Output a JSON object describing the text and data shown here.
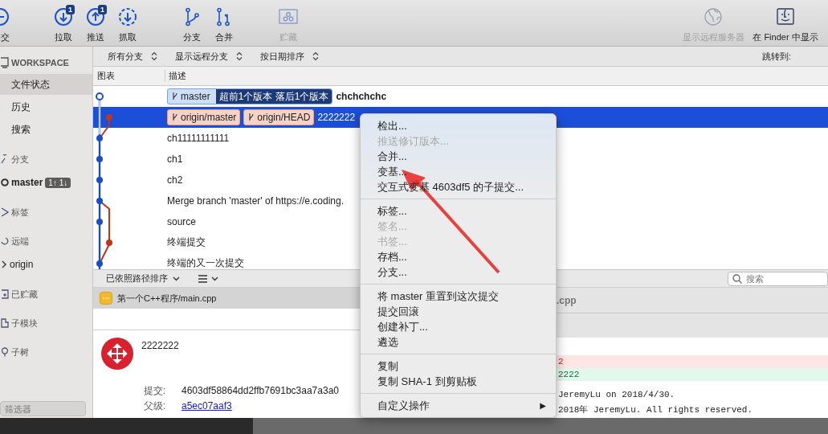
{
  "toolbar": {
    "groups": [
      [
        {
          "label": "交",
          "disabled": false
        }
      ],
      [
        {
          "label": "拉取",
          "badge": "1",
          "disabled": false
        },
        {
          "label": "推送",
          "badge": "1",
          "disabled": false
        },
        {
          "label": "抓取",
          "disabled": false
        }
      ],
      [
        {
          "label": "分支",
          "disabled": false
        },
        {
          "label": "合并",
          "disabled": false
        }
      ],
      [
        {
          "label": "贮藏",
          "disabled": true
        }
      ]
    ],
    "right_items": [
      {
        "label": "显示远程服务器",
        "disabled": true
      },
      {
        "label": "在 Finder 中显示",
        "disabled": false
      }
    ]
  },
  "sidebar": {
    "workspace": {
      "label": "WORKSPACE",
      "items": [
        {
          "label": "文件状态",
          "selected": true
        },
        {
          "label": "历史",
          "selected": false
        },
        {
          "label": "搜索",
          "selected": false
        }
      ]
    },
    "sections": [
      {
        "label": "分支",
        "children": [
          {
            "label": "master",
            "badge": "1↑ 1↓",
            "kind": "current"
          }
        ]
      },
      {
        "label": "标签"
      },
      {
        "label": "远端",
        "children": [
          {
            "label": "origin",
            "kind": "remote",
            "expanded": false
          }
        ]
      },
      {
        "label": "已贮藏"
      },
      {
        "label": "子模块"
      },
      {
        "label": "子树"
      }
    ],
    "filter": {
      "placeholder": "筛选器"
    }
  },
  "filter_bar": {
    "dropdowns": [
      "所有分支",
      "显示远程分支",
      "按日期排序"
    ],
    "jump_label": "跳转到:"
  },
  "table": {
    "columns": [
      "图表",
      "描述"
    ],
    "rows": [
      {
        "selected": false,
        "head": true,
        "tags": [
          {
            "label": "master",
            "kind": "local"
          }
        ],
        "status": "超前1个版本 落后1个版本",
        "message": "chchchchc"
      },
      {
        "selected": true,
        "head": false,
        "tags": [
          {
            "label": "origin/master",
            "kind": "remote"
          },
          {
            "label": "origin/HEAD",
            "kind": "remote"
          }
        ],
        "message": "2222222"
      },
      {
        "selected": false,
        "head": false,
        "message": "ch11111111111"
      },
      {
        "selected": false,
        "head": false,
        "message": "ch1"
      },
      {
        "selected": false,
        "head": false,
        "message": "ch2"
      },
      {
        "selected": false,
        "head": false,
        "message": "Merge branch 'master' of https://e.coding."
      },
      {
        "selected": false,
        "head": false,
        "message": "source"
      },
      {
        "selected": false,
        "head": false,
        "message": "终端提交"
      },
      {
        "selected": false,
        "head": false,
        "message": "终端的又一次提交"
      }
    ]
  },
  "file_panel": {
    "sort_label": "已依照路径排序",
    "search": {
      "placeholder": "搜索"
    },
    "files": [
      {
        "path": "第一个C++程序/main.cpp",
        "selected": true
      }
    ],
    "commit": {
      "message": "2222222",
      "fields": [
        {
          "label": "提交:",
          "value": "4603df58864dd2ffb7691bc3aa7a3a0",
          "kind": "text"
        },
        {
          "label": "父级:",
          "value": "a5ec07aaf3",
          "kind": "link"
        }
      ]
    }
  },
  "diff": {
    "file_header": ".cpp",
    "lines": [
      {
        "text": "2",
        "kind": "removed"
      },
      {
        "text": "2222",
        "kind": "added"
      },
      {
        "text": "JeremyLu on 2018/4/30.",
        "kind": "context"
      },
      {
        "text": "2018年 JeremyLu. All rights reserved.",
        "kind": "context"
      }
    ]
  },
  "context_menu": {
    "groups": [
      [
        {
          "label": "检出...",
          "disabled": false
        },
        {
          "label": "推送修订版本...",
          "disabled": true
        },
        {
          "label": "合并...",
          "disabled": false
        },
        {
          "label": "变基...",
          "disabled": false
        },
        {
          "label": "交互式变基 4603df5 的子提交...",
          "disabled": false
        }
      ],
      [
        {
          "label": "标签...",
          "disabled": false
        },
        {
          "label": "签名...",
          "disabled": true
        },
        {
          "label": "书签...",
          "disabled": true
        },
        {
          "label": "存档...",
          "disabled": false
        },
        {
          "label": "分支...",
          "disabled": false
        }
      ],
      [
        {
          "label": "将 master 重置到这次提交",
          "disabled": false
        },
        {
          "label": "提交回滚",
          "disabled": false
        },
        {
          "label": "创建补丁...",
          "disabled": false
        },
        {
          "label": "遴选",
          "disabled": false
        }
      ],
      [
        {
          "label": "复制",
          "disabled": false
        },
        {
          "label": "复制 SHA-1 到剪贴板",
          "disabled": false
        }
      ],
      [
        {
          "label": "自定义操作",
          "disabled": false,
          "kind": "submenu",
          "arrow": "▶"
        }
      ]
    ]
  }
}
